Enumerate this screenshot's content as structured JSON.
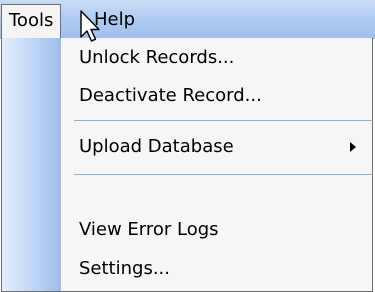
{
  "menubar": {
    "items": [
      {
        "label": "Tools"
      },
      {
        "label": "Help"
      }
    ]
  },
  "dropdown": {
    "items": [
      {
        "label": "Unlock Records..."
      },
      {
        "label": "Deactivate Record..."
      },
      {
        "label": "Upload Database"
      },
      {
        "label": "View Error Logs"
      },
      {
        "label": "Settings..."
      }
    ]
  },
  "icons": {
    "submenu": "chevron-right-icon",
    "pointer": "mouse-cursor-icon"
  },
  "colors": {
    "menubar": "#aecaf0",
    "separator": "#8eaee0",
    "menu_background": "#f6f6f6"
  }
}
